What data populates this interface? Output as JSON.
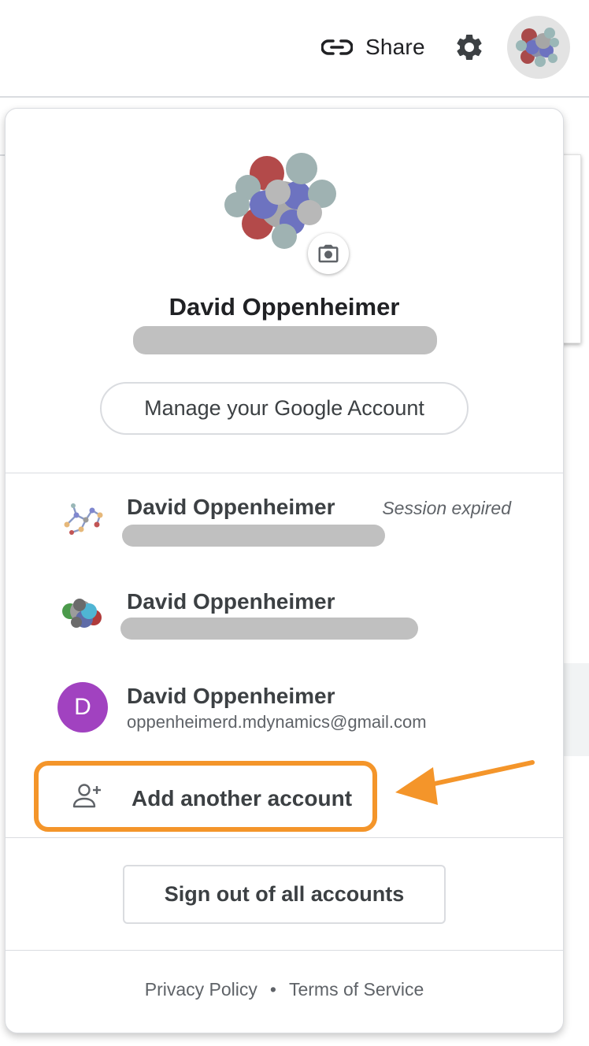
{
  "topbar": {
    "share_label": "Share",
    "share_icon": "link-icon",
    "settings_icon": "gear-icon",
    "avatar": "molecule-avatar"
  },
  "account_menu": {
    "current": {
      "name": "David Oppenheimer",
      "email_redacted": true,
      "camera_icon": "camera-icon"
    },
    "manage_label": "Manage your Google Account",
    "accounts": [
      {
        "name": "David Oppenheimer",
        "status": "Session expired",
        "email_redacted": true,
        "avatar": "ball-and-stick-molecule"
      },
      {
        "name": "David Oppenheimer",
        "status": "",
        "email_redacted": true,
        "avatar": "space-filling-molecule"
      },
      {
        "name": "David Oppenheimer",
        "status": "",
        "email": "oppenheimerd.mdynamics@gmail.com",
        "avatar_letter": "D",
        "avatar_color": "#a142c0"
      }
    ],
    "add_account_label": "Add another account",
    "add_account_icon": "person-add-icon",
    "sign_out_label": "Sign out of all accounts",
    "footer": {
      "privacy_label": "Privacy Policy",
      "separator": "•",
      "terms_label": "Terms of Service"
    }
  },
  "annotation": {
    "highlight_color": "#f4952a",
    "arrow_icon": "arrow-left-icon"
  }
}
